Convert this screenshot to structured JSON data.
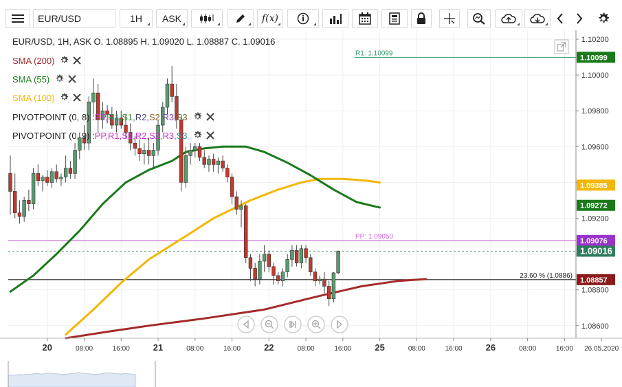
{
  "toolbar": {
    "symbol": "EUR/USD",
    "interval": "1H",
    "price_type": "ASK",
    "fx_label": "f(x)"
  },
  "header": {
    "instrument_line": "EUR/USD, 1H, ASK   O. 1.08895 H. 1.09020 L. 1.08887 C. 1.09016"
  },
  "indicators": [
    {
      "label": "SMA (200)",
      "color": "#a52a2a"
    },
    {
      "label": "SMA (55)",
      "color": "#1a7a1a"
    },
    {
      "label": "SMA (100)",
      "color": "#f2b705"
    }
  ],
  "pivot_indicators": [
    {
      "label": "PIVOTPOINT (0, 8)",
      "parts": [
        {
          "text": "PP",
          "color": "#cc33cc"
        },
        {
          "text": "R1",
          "color": "#2a9a6a"
        },
        {
          "text": "S1",
          "color": "#3a8a3a"
        },
        {
          "text": "R2",
          "color": "#444488"
        },
        {
          "text": "S2",
          "color": "#996633"
        },
        {
          "text": "R3",
          "color": "#8844aa"
        },
        {
          "text": "S3",
          "color": "#6a6a2a"
        }
      ]
    },
    {
      "label": "PIVOTPOINT (0, 9)",
      "parts": [
        {
          "text": "PP",
          "color": "#cc33cc"
        },
        {
          "text": "R1",
          "color": "#cc33cc"
        },
        {
          "text": "S1",
          "color": "#cc33cc"
        },
        {
          "text": "R2",
          "color": "#cc33cc"
        },
        {
          "text": "S2",
          "color": "#cc33cc"
        },
        {
          "text": "R3",
          "color": "#cc33cc"
        },
        {
          "text": "S3",
          "color": "#2a9aaa"
        }
      ]
    }
  ],
  "chart_data": {
    "type": "candlestick",
    "ylim": [
      1.0853,
      1.1025
    ],
    "yticks": [
      "1.10200",
      "1.10000",
      "1.09800",
      "1.09600",
      "1.09400",
      "1.09200",
      "1.09000",
      "1.08800",
      "1.08600"
    ],
    "ytick_values": [
      1.102,
      1.1,
      1.098,
      1.096,
      1.094,
      1.092,
      1.09,
      1.088,
      1.086
    ],
    "xticks": [
      {
        "label": "20",
        "bold": true,
        "slot": 8
      },
      {
        "label": "08:00",
        "bold": false,
        "slot": 16
      },
      {
        "label": "16:00",
        "bold": false,
        "slot": 24
      },
      {
        "label": "21",
        "bold": true,
        "slot": 32
      },
      {
        "label": "08:00",
        "bold": false,
        "slot": 40
      },
      {
        "label": "16:00",
        "bold": false,
        "slot": 48
      },
      {
        "label": "22",
        "bold": true,
        "slot": 56
      },
      {
        "label": "08:00",
        "bold": false,
        "slot": 64
      },
      {
        "label": "16:00",
        "bold": false,
        "slot": 72
      },
      {
        "label": "25",
        "bold": true,
        "slot": 80
      },
      {
        "label": "08:00",
        "bold": false,
        "slot": 88
      },
      {
        "label": "16:00",
        "bold": false,
        "slot": 96
      },
      {
        "label": "26",
        "bold": true,
        "slot": 104
      },
      {
        "label": "08:00",
        "bold": false,
        "slot": 112
      },
      {
        "label": "16:00",
        "bold": false,
        "slot": 120
      },
      {
        "label": "26.05.2020",
        "bold": false,
        "slot": 128
      }
    ],
    "candles": [
      [
        1.0945,
        1.0955,
        1.0922,
        1.0935
      ],
      [
        1.0935,
        1.0945,
        1.092,
        1.0923
      ],
      [
        1.0923,
        1.093,
        1.0917,
        1.0921
      ],
      [
        1.0921,
        1.0932,
        1.0918,
        1.093
      ],
      [
        1.093,
        1.0936,
        1.0924,
        1.0928
      ],
      [
        1.0928,
        1.0948,
        1.0925,
        1.0945
      ],
      [
        1.0945,
        1.095,
        1.0938,
        1.0941
      ],
      [
        1.0941,
        1.0944,
        1.0935,
        1.0943
      ],
      [
        1.0943,
        1.0947,
        1.0938,
        1.094
      ],
      [
        1.094,
        1.0948,
        1.0937,
        1.0946
      ],
      [
        1.0946,
        1.095,
        1.094,
        1.0942
      ],
      [
        1.0942,
        1.0945,
        1.0938,
        1.0943
      ],
      [
        1.0943,
        1.0955,
        1.094,
        1.0948
      ],
      [
        1.0948,
        1.0952,
        1.0942,
        1.0945
      ],
      [
        1.0945,
        1.0962,
        1.0942,
        1.0958
      ],
      [
        1.0958,
        1.0968,
        1.0953,
        1.0965
      ],
      [
        1.0965,
        1.0972,
        1.0958,
        1.0962
      ],
      [
        1.0962,
        1.0988,
        1.0958,
        1.0985
      ],
      [
        1.0985,
        1.0998,
        1.0978,
        1.099
      ],
      [
        1.099,
        1.0995,
        1.0968,
        1.0975
      ],
      [
        1.0975,
        1.0985,
        1.097,
        1.098
      ],
      [
        1.098,
        1.0983,
        1.0973,
        1.0978
      ],
      [
        1.0978,
        1.0982,
        1.097,
        1.0972
      ],
      [
        1.0972,
        1.098,
        1.0968,
        1.0976
      ],
      [
        1.0976,
        1.098,
        1.097,
        1.0972
      ],
      [
        1.0972,
        1.0978,
        1.0965,
        1.0968
      ],
      [
        1.0968,
        1.0973,
        1.0958,
        1.0962
      ],
      [
        1.0962,
        1.0966,
        1.0955,
        1.0959
      ],
      [
        1.0959,
        1.0964,
        1.0952,
        1.0956
      ],
      [
        1.0956,
        1.0962,
        1.095,
        1.0958
      ],
      [
        1.0958,
        1.0965,
        1.095,
        1.0955
      ],
      [
        1.0955,
        1.0962,
        1.0948,
        1.0958
      ],
      [
        1.0958,
        1.0975,
        1.0955,
        1.0972
      ],
      [
        1.0972,
        1.0985,
        1.0968,
        1.0982
      ],
      [
        1.0982,
        1.0998,
        1.0978,
        1.0995
      ],
      [
        1.0995,
        1.1005,
        1.0985,
        1.0988
      ],
      [
        1.0988,
        1.0995,
        1.097,
        1.0975
      ],
      [
        1.0975,
        1.0978,
        1.0935,
        1.094
      ],
      [
        1.094,
        1.096,
        1.0937,
        1.0955
      ],
      [
        1.0955,
        1.0962,
        1.095,
        1.0958
      ],
      [
        1.0958,
        1.0962,
        1.0954,
        1.096
      ],
      [
        1.096,
        1.0962,
        1.0952,
        1.0954
      ],
      [
        1.0954,
        1.0958,
        1.0948,
        1.095
      ],
      [
        1.095,
        1.0955,
        1.0946,
        1.0953
      ],
      [
        1.0953,
        1.0956,
        1.0946,
        1.095
      ],
      [
        1.095,
        1.0954,
        1.0945,
        1.0952
      ],
      [
        1.0952,
        1.0955,
        1.0946,
        1.0948
      ],
      [
        1.0948,
        1.095,
        1.094,
        1.0943
      ],
      [
        1.0943,
        1.0945,
        1.0928,
        1.0932
      ],
      [
        1.0932,
        1.0935,
        1.0922,
        1.0925
      ],
      [
        1.0925,
        1.093,
        1.0915,
        1.0927
      ],
      [
        1.0927,
        1.0928,
        1.0895,
        1.0898
      ],
      [
        1.0898,
        1.09,
        1.0885,
        1.0892
      ],
      [
        1.0892,
        1.0895,
        1.0882,
        1.0886
      ],
      [
        1.0886,
        1.09,
        1.0883,
        1.0896
      ],
      [
        1.0896,
        1.0905,
        1.089,
        1.09
      ],
      [
        1.09,
        1.0902,
        1.089,
        1.0893
      ],
      [
        1.0893,
        1.0895,
        1.0883,
        1.0888
      ],
      [
        1.0888,
        1.089,
        1.0883,
        1.0885
      ],
      [
        1.0885,
        1.0892,
        1.0882,
        1.089
      ],
      [
        1.089,
        1.09,
        1.0887,
        1.0897
      ],
      [
        1.0897,
        1.0905,
        1.0893,
        1.0902
      ],
      [
        1.0902,
        1.0905,
        1.0893,
        1.0895
      ],
      [
        1.0895,
        1.0905,
        1.0892,
        1.0903
      ],
      [
        1.0903,
        1.0905,
        1.0895,
        1.0898
      ],
      [
        1.0898,
        1.09,
        1.0888,
        1.089
      ],
      [
        1.089,
        1.0892,
        1.0882,
        1.0885
      ],
      [
        1.0885,
        1.0888,
        1.0883,
        1.0886
      ],
      [
        1.0886,
        1.089,
        1.0878,
        1.0882
      ],
      [
        1.0882,
        1.0885,
        1.0871,
        1.0875
      ],
      [
        1.0875,
        1.089,
        1.0873,
        1.08895
      ],
      [
        1.08895,
        1.0902,
        1.08887,
        1.09016
      ]
    ],
    "candle_start_slot": 0,
    "sma_200": [
      [
        12,
        1.0853
      ],
      [
        22,
        1.0857
      ],
      [
        30,
        1.086
      ],
      [
        42,
        1.0864
      ],
      [
        55,
        1.0869
      ],
      [
        66,
        1.0876
      ],
      [
        76,
        1.0882
      ],
      [
        84,
        1.0885
      ],
      [
        90,
        1.0886
      ]
    ],
    "sma_55": [
      [
        0,
        1.0879
      ],
      [
        5,
        1.0888
      ],
      [
        10,
        1.09
      ],
      [
        15,
        1.0913
      ],
      [
        20,
        1.0928
      ],
      [
        25,
        1.094
      ],
      [
        30,
        1.0947
      ],
      [
        35,
        1.0952
      ],
      [
        38,
        1.0957
      ],
      [
        42,
        1.0959
      ],
      [
        46,
        1.096
      ],
      [
        51,
        1.096
      ],
      [
        55,
        1.0957
      ],
      [
        60,
        1.0951
      ],
      [
        65,
        1.0944
      ],
      [
        70,
        1.0936
      ],
      [
        75,
        1.0929
      ],
      [
        80,
        1.0926
      ]
    ],
    "sma_100": [
      [
        12,
        1.0855
      ],
      [
        18,
        1.0869
      ],
      [
        24,
        1.0884
      ],
      [
        30,
        1.0897
      ],
      [
        38,
        1.091
      ],
      [
        44,
        1.092
      ],
      [
        52,
        1.093
      ],
      [
        58,
        1.0936
      ],
      [
        63,
        1.094
      ],
      [
        67,
        1.0942
      ],
      [
        72,
        1.0942
      ],
      [
        77,
        1.0941
      ],
      [
        80,
        1.094
      ]
    ],
    "levels": [
      {
        "name": "R1",
        "value": 1.10099,
        "label": "R1: 1.10099",
        "color": "#2a9a6a",
        "badge": "1.10099",
        "badge_color": "#1a7a1a"
      },
      {
        "name": "PP",
        "value": 1.09076,
        "label": "PP: 1.09050",
        "color": "#cc66dd",
        "badge": "1.09076",
        "badge_color": "#9933cc"
      },
      {
        "name": "Fib",
        "value": 1.08857,
        "label": "23.60 % (1.0886)",
        "color": "#222222",
        "badge": "1.08857",
        "badge_color": "#8b1a1a"
      }
    ],
    "current_price": {
      "value": 1.09016,
      "badge": "1.09016",
      "color": "#2e7d5b"
    },
    "sma100_badge": {
      "value": 1.09385,
      "badge": "1.09385",
      "color": "#f2b705"
    },
    "sma55_badge": {
      "value": 1.09272,
      "badge": "1.09272",
      "color": "#1a7a1a"
    }
  },
  "navigator_series": [
    30,
    32,
    31,
    33,
    32,
    34,
    33,
    35,
    36,
    34,
    35,
    37,
    36,
    35,
    34,
    33,
    34,
    35,
    36,
    38,
    37,
    36,
    35,
    34,
    33,
    34,
    36,
    38,
    37,
    36,
    35,
    34,
    36,
    35,
    34,
    33
  ]
}
